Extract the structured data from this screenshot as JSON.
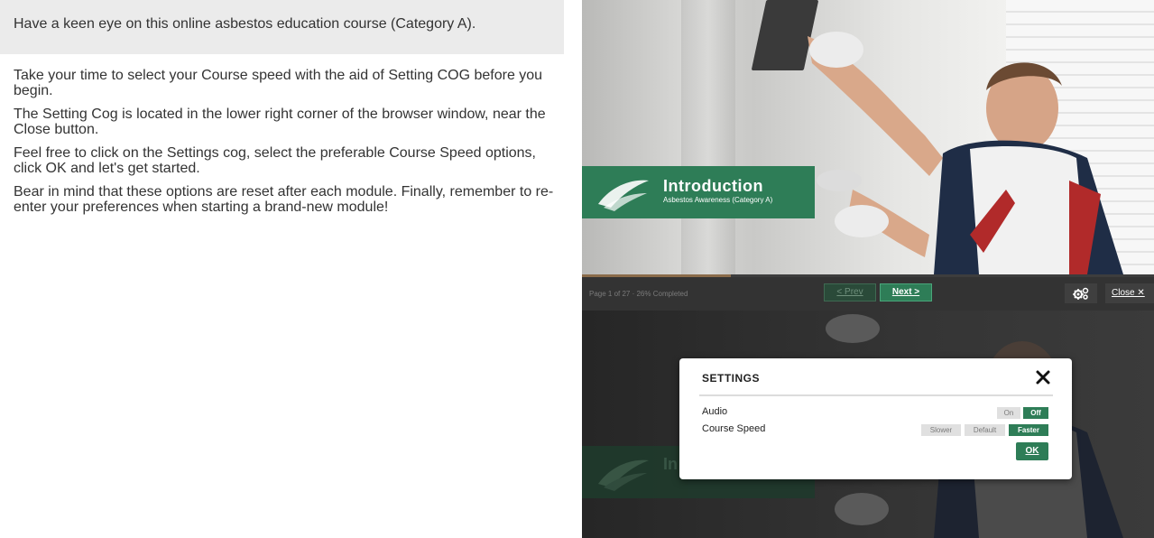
{
  "banner": {
    "text": "Have a keen eye on this online asbestos education course (Category A)."
  },
  "instructions": [
    "Take your time to select your Course speed with the aid of Setting COG before you begin.",
    "The Setting Cog is located in the lower right corner of the browser window, near the Close button.",
    "Feel free to click on the Settings cog, select the preferable Course Speed options, click OK and let's get started.",
    "Bear in mind that these options are reset after each module. Finally, remember to re-enter your preferences when starting a brand-new module!"
  ],
  "course": {
    "intro": {
      "title": "Introduction",
      "subtitle": "Asbestos Awareness (Category A)"
    },
    "nav": {
      "page_info": "Page 1 of 27 · 26% Completed",
      "progress": 0.26,
      "prev_label": "< Prev",
      "next_label": "Next >",
      "close_label": "Close ✕"
    },
    "settings": {
      "title": "SETTINGS",
      "audio_label": "Audio",
      "audio_options": [
        "On",
        "Off"
      ],
      "audio_selected": "Off",
      "speed_label": "Course Speed",
      "speed_options": [
        "Slower",
        "Default",
        "Faster"
      ],
      "speed_selected": "Faster",
      "ok_label": "OK"
    },
    "dim_intro_fragment": "In"
  },
  "colors": {
    "accent": "#2e7d57",
    "banner_bg": "#ebebeb",
    "nav_bg": "#333333"
  }
}
